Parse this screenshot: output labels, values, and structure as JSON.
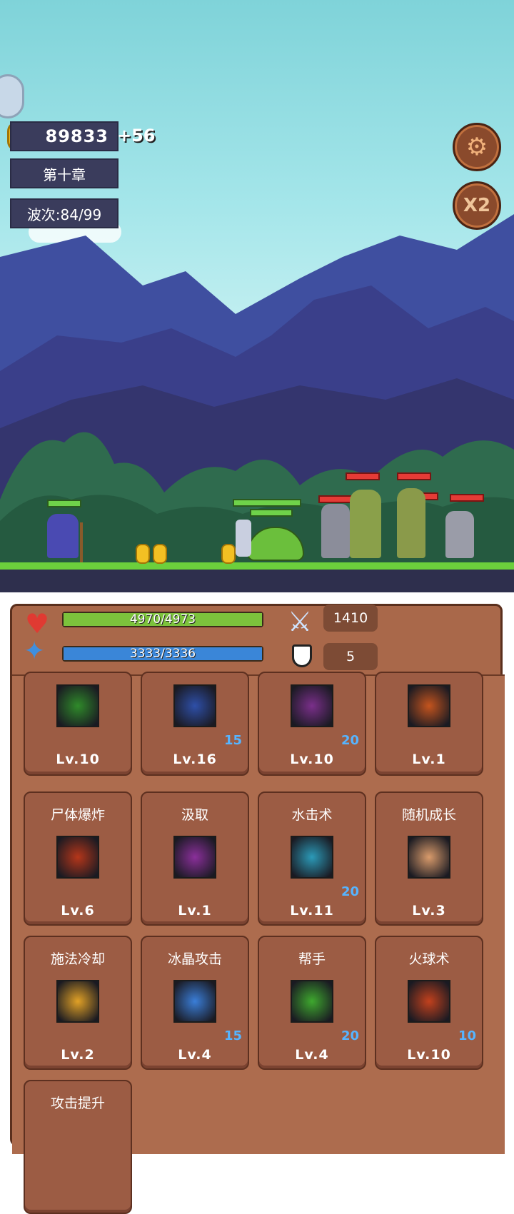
{
  "hud": {
    "gold": "89833",
    "gold_gain": "+56",
    "chapter": "第十章",
    "wave": "波次:84/99",
    "speed_label": "X2"
  },
  "stats": {
    "hp": "4970/4973",
    "hp_fill": 0.999,
    "mp": "3333/3336",
    "mp_fill": 0.999,
    "attack": "1410",
    "defense": "5"
  },
  "skills": [
    {
      "name": "",
      "lv": "Lv.10",
      "count": "",
      "color": "#2f8a2a"
    },
    {
      "name": "",
      "lv": "Lv.16",
      "count": "15",
      "color": "#2e4fa8"
    },
    {
      "name": "",
      "lv": "Lv.10",
      "count": "20",
      "color": "#7a2f8a"
    },
    {
      "name": "",
      "lv": "Lv.1",
      "count": "",
      "color": "#c4541e"
    },
    {
      "name": "尸体爆炸",
      "lv": "Lv.6",
      "count": "",
      "color": "#b5361a"
    },
    {
      "name": "汲取",
      "lv": "Lv.1",
      "count": "",
      "color": "#8a2f9a"
    },
    {
      "name": "水击术",
      "lv": "Lv.11",
      "count": "20",
      "color": "#2b9ab8"
    },
    {
      "name": "随机成长",
      "lv": "Lv.3",
      "count": "",
      "color": "#d99b6b"
    },
    {
      "name": "施法冷却",
      "lv": "Lv.2",
      "count": "",
      "color": "#e1a126"
    },
    {
      "name": "冰晶攻击",
      "lv": "Lv.4",
      "count": "15",
      "color": "#3a7ed8"
    },
    {
      "name": "帮手",
      "lv": "Lv.4",
      "count": "20",
      "color": "#3ea82e"
    },
    {
      "name": "火球术",
      "lv": "Lv.10",
      "count": "10",
      "color": "#c2411d"
    },
    {
      "name": "攻击提升",
      "lv": "",
      "count": "",
      "color": ""
    }
  ]
}
